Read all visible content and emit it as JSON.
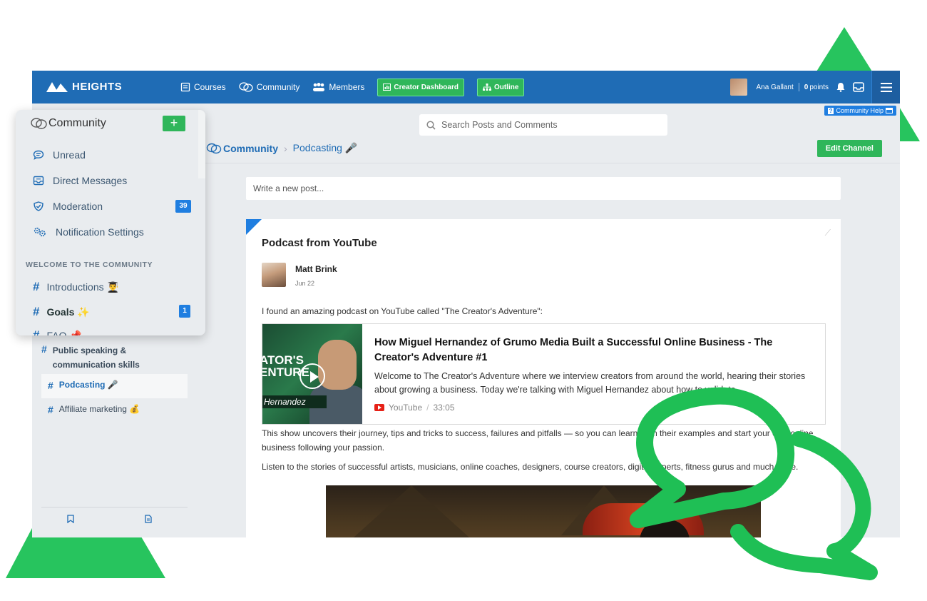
{
  "app": {
    "logo_text": "HEIGHTS",
    "brand_color": "#1f6cb5",
    "accent_green": "#2fb65a"
  },
  "topnav": {
    "items": [
      {
        "label": "Courses",
        "icon": "book-icon"
      },
      {
        "label": "Community",
        "icon": "chat-icon"
      },
      {
        "label": "Members",
        "icon": "members-icon"
      }
    ],
    "creator_dashboard": "Creator Dashboard",
    "outline": "Outline",
    "user_name": "Ana Gallant",
    "points_value": "0",
    "points_label": "points"
  },
  "help_label": "Community Help",
  "search": {
    "placeholder": "Search Posts and Comments"
  },
  "breadcrumb": {
    "root": "Community",
    "current": "Podcasting 🎤"
  },
  "edit_channel": "Edit Channel",
  "write_post": "Write a new post...",
  "post": {
    "title": "Podcast from YouTube",
    "author": "Matt Brink",
    "date": "Jun 22",
    "intro": "I found an amazing podcast on YouTube called \"The Creator's Adventure\":",
    "video": {
      "thumb_text": "ATOR'S\nENTURE",
      "thumb_name": "Hernandez",
      "title": "How Miguel Hernandez of Grumo Media Built a Successful Online Business - The Creator's Adventure #1",
      "description": "Welcome to The Creator's Adventure where we interview creators from around the world, hearing their stories about growing a business. Today we're talking with Miguel Hernandez about how to validate...",
      "source": "YouTube",
      "duration": "33:05"
    },
    "body1": "This show uncovers their journey, tips and tricks to success, failures and pitfalls — so you can learn from their examples and start your own online business following your passion.",
    "body2": "Listen to the stories of successful artists, musicians, online coaches, designers, course creators, digital experts, fitness gurus and much more."
  },
  "panel": {
    "title": "Community",
    "add": "+",
    "items": [
      {
        "label": "Unread",
        "icon": "chat-bubble-icon"
      },
      {
        "label": "Direct Messages",
        "icon": "inbox-icon"
      },
      {
        "label": "Moderation",
        "icon": "shield-icon",
        "badge": "39"
      },
      {
        "label": "Notification Settings",
        "icon": "gears-icon"
      }
    ],
    "section": "WELCOME TO THE COMMUNITY",
    "channels": [
      {
        "label": "Introductions 👨‍🎓"
      },
      {
        "label": "Goals ✨",
        "badge": "1"
      },
      {
        "label": "FAQ 📌"
      }
    ]
  },
  "sidebar_channels": [
    {
      "label": "Public speaking & communication skills 🗣"
    },
    {
      "label": "Podcasting 🎤"
    },
    {
      "label": "Affiliate marketing 💰"
    }
  ]
}
